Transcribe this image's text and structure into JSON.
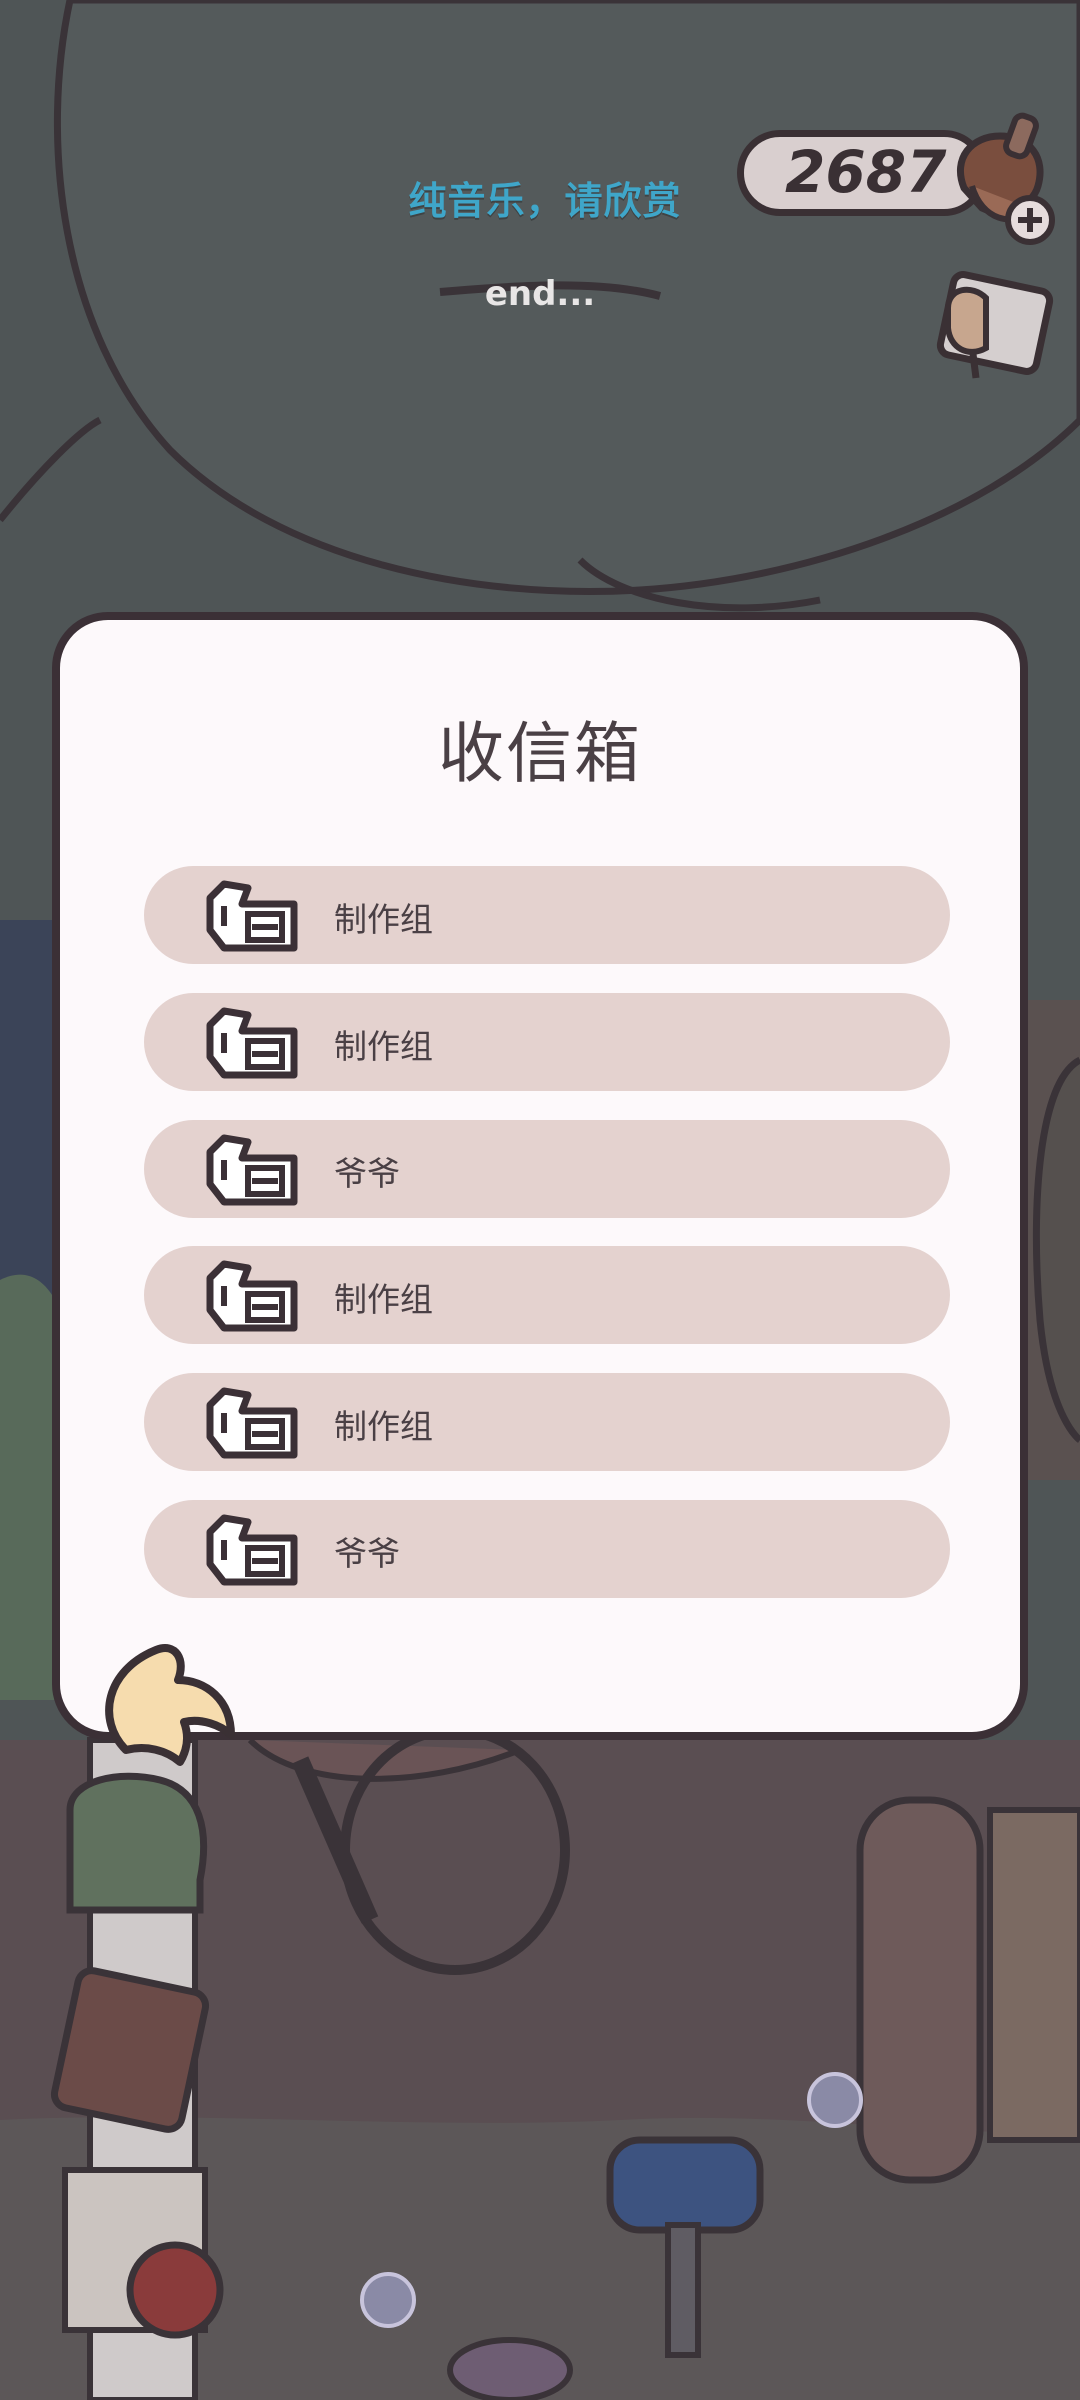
{
  "hud": {
    "lyric_line_1": "纯音乐，请欣赏",
    "lyric_line_2": "end...",
    "coin_count": "2687",
    "coin_icon": "acorn-plus-icon",
    "mail_icon": "envelope-icon"
  },
  "inbox": {
    "title": "收信箱",
    "back_icon": "curl-arrow-icon",
    "letters": [
      {
        "sender": "制作组",
        "icon": "letter-icon"
      },
      {
        "sender": "制作组",
        "icon": "letter-icon"
      },
      {
        "sender": "爷爷",
        "icon": "letter-icon"
      },
      {
        "sender": "制作组",
        "icon": "letter-icon"
      },
      {
        "sender": "制作组",
        "icon": "letter-icon"
      },
      {
        "sender": "爷爷",
        "icon": "letter-icon"
      }
    ]
  },
  "colors": {
    "panel_bg": "#fdf9fb",
    "row_bg": "#e4d2cf",
    "outline": "#3b3036",
    "lyric": "#3fa6c9"
  }
}
